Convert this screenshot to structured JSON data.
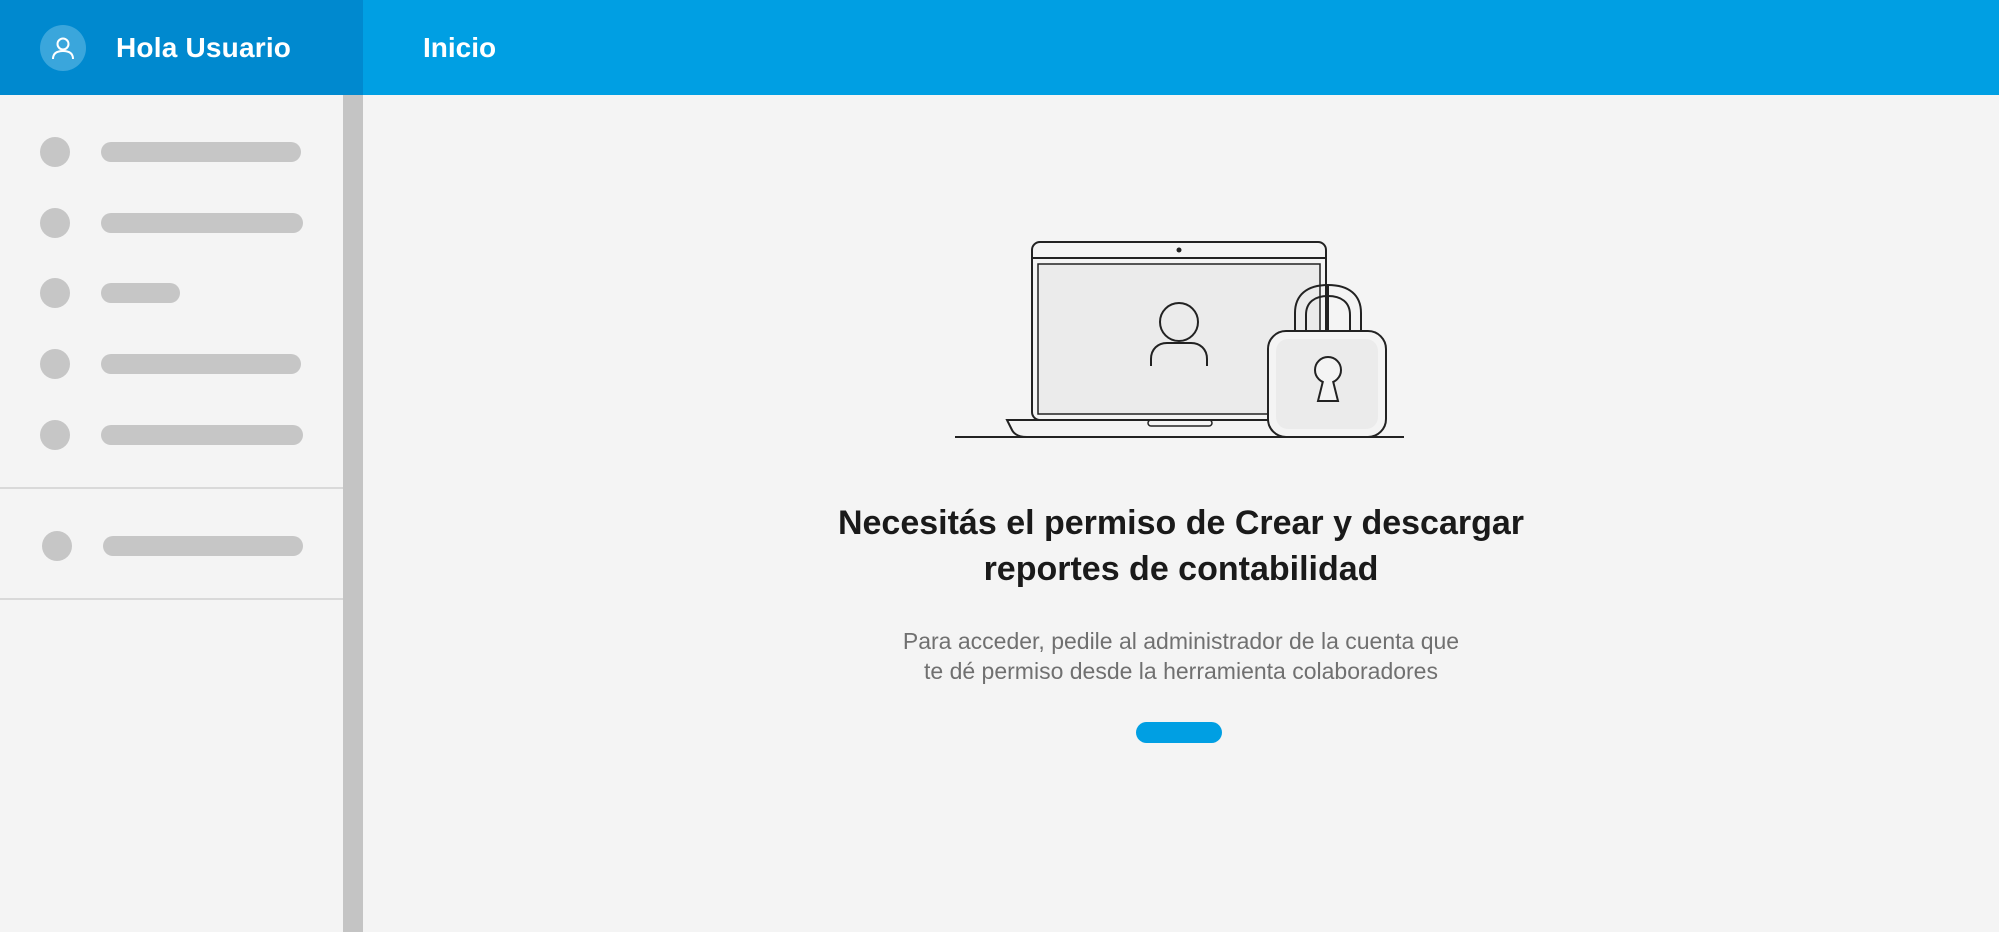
{
  "header": {
    "greeting": "Hola Usuario",
    "title": "Inicio",
    "user_icon": "user-icon"
  },
  "main": {
    "illustration": "laptop-lock-illustration",
    "heading_line1": "Necesitás el permiso de Crear y descargar",
    "heading_line2": "reportes de contabilidad",
    "sub_line1": "Para acceder, pedile al administrador de la cuenta que",
    "sub_line2": "te dé permiso desde la herramienta colaboradores"
  },
  "colors": {
    "header_left": "#0089cf",
    "header_right": "#009fe3",
    "background": "#f4f4f4",
    "skeleton": "#c6c6c6",
    "accent": "#009fe3"
  }
}
